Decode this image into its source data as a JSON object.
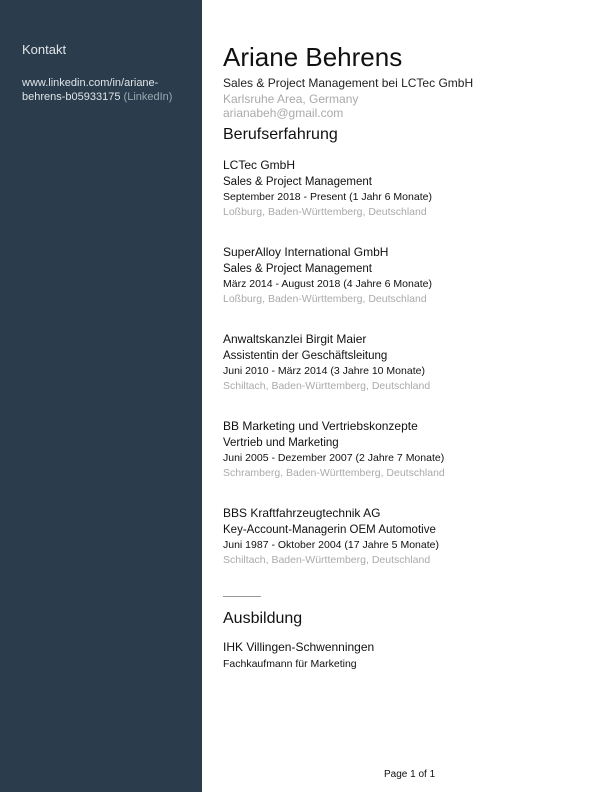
{
  "sidebar": {
    "contact_heading": "Kontakt",
    "linkedin_url": "www.linkedin.com/in/ariane-behrens-b05933175",
    "linkedin_suffix": "(LinkedIn)"
  },
  "profile": {
    "name": "Ariane Behrens",
    "headline": "Sales & Project Management bei LCTec GmbH",
    "location": "Karlsruhe Area, Germany",
    "email": "arianabeh@gmail.com"
  },
  "experience": {
    "title": "Berufserfahrung",
    "jobs": [
      {
        "company": "LCTec GmbH",
        "role": "Sales & Project Management",
        "dates": "September 2018 - Present (1 Jahr 6 Monate)",
        "place": "Loßburg, Baden-Württemberg, Deutschland"
      },
      {
        "company": "SuperAlloy International GmbH",
        "role": "Sales & Project Management",
        "dates": "März 2014 - August 2018 (4 Jahre 6 Monate)",
        "place": "Loßburg, Baden-Württemberg, Deutschland"
      },
      {
        "company": "Anwaltskanzlei Birgit Maier",
        "role": "Assistentin der Geschäftsleitung",
        "dates": "Juni 2010 - März 2014 (3 Jahre 10 Monate)",
        "place": "Schiltach, Baden-Württemberg, Deutschland"
      },
      {
        "company": "BB Marketing und Vertriebskonzepte",
        "role": "Vertrieb und Marketing",
        "dates": "Juni 2005 - Dezember 2007 (2 Jahre 7 Monate)",
        "place": "Schramberg, Baden-Württemberg, Deutschland"
      },
      {
        "company": "BBS Kraftfahrzeugtechnik AG",
        "role": "Key-Account-Managerin OEM Automotive",
        "dates": "Juni 1987 - Oktober 2004 (17 Jahre 5 Monate)",
        "place": "Schiltach, Baden-Württemberg, Deutschland"
      }
    ]
  },
  "education": {
    "title": "Ausbildung",
    "school": "IHK Villingen-Schwenningen",
    "degree": "Fachkaufmann für Marketing"
  },
  "footer": {
    "page_label": "Page 1 of 1"
  }
}
